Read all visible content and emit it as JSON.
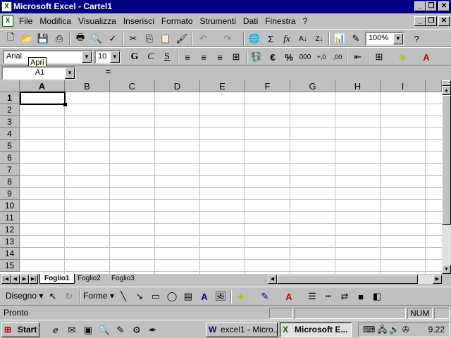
{
  "window": {
    "title": "Microsoft Excel - Cartel1",
    "min": "_",
    "restore": "❐",
    "close": "✕"
  },
  "menu": [
    "File",
    "Modifica",
    "Visualizza",
    "Inserisci",
    "Formato",
    "Strumenti",
    "Dati",
    "Finestra",
    "?"
  ],
  "standard_toolbar": {
    "zoom": "100%"
  },
  "format_toolbar": {
    "font": "Arial",
    "size": "10",
    "bold": "G",
    "italic": "C",
    "underline": "S",
    "currency": "€",
    "percent": "%",
    "thousands": "000"
  },
  "tooltip": "Apri",
  "formula_bar": {
    "name_box": "A1",
    "equals": "="
  },
  "columns": [
    "A",
    "B",
    "C",
    "D",
    "E",
    "F",
    "G",
    "H",
    "I"
  ],
  "rows": [
    "1",
    "2",
    "3",
    "4",
    "5",
    "6",
    "7",
    "8",
    "9",
    "10",
    "11",
    "12",
    "13",
    "14",
    "15"
  ],
  "sheets": [
    "Foglio1",
    "Foglio2",
    "Foglio3"
  ],
  "drawing_toolbar": {
    "draw": "Disegno",
    "shapes": "Forme"
  },
  "status": {
    "text": "Pronto",
    "num": "NUM"
  },
  "taskbar": {
    "start": "Start",
    "btn1": "excel1 - Micro...",
    "btn2": "Microsoft E...",
    "clock": "9.22"
  }
}
